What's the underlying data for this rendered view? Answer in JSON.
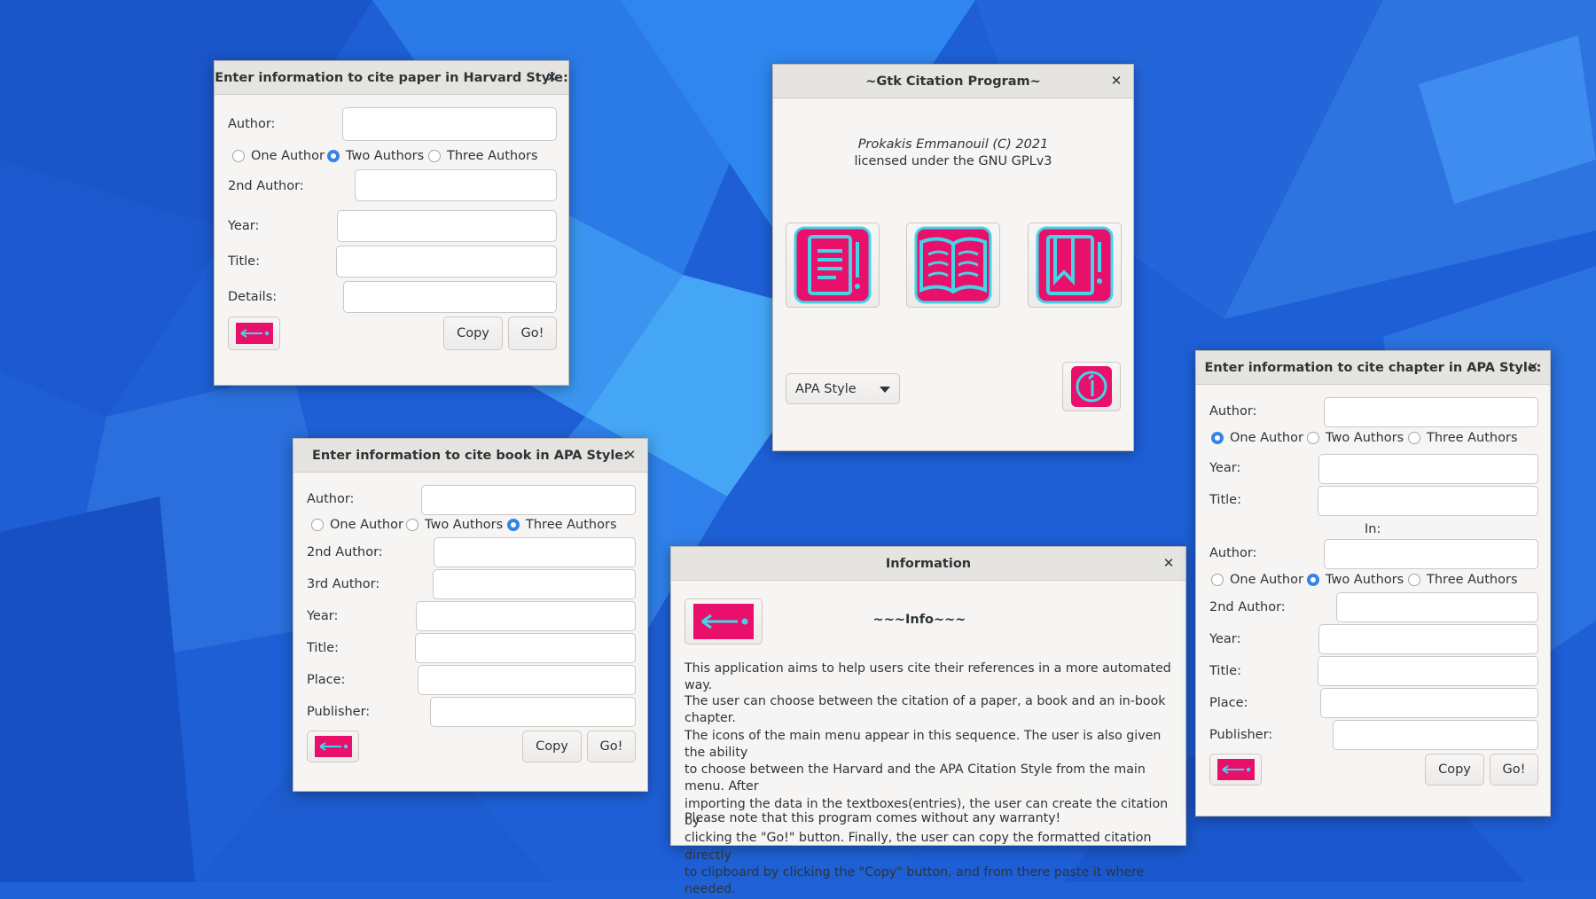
{
  "colors": {
    "accent": "#3584e4",
    "icon_fill": "#e8106b",
    "icon_stroke": "#44d4e6"
  },
  "harvard": {
    "title": "Enter information to cite paper in Harvard Style:",
    "author_label": "Author:",
    "radios": [
      "One Author",
      "Two Authors",
      "Three Authors"
    ],
    "selected": "Two Authors",
    "author2_label": "2nd Author:",
    "year_label": "Year:",
    "title_label": "Title:",
    "details_label": "Details:",
    "copy": "Copy",
    "go": "Go!"
  },
  "main": {
    "title": "~Gtk Citation Program~",
    "credit_line1": "Prokakis Emmanouil (C) 2021",
    "credit_line2": "licensed under the GNU GPLv3",
    "style_select": "APA Style",
    "icons": [
      "paper-icon",
      "book-icon",
      "chapter-icon",
      "info-icon"
    ]
  },
  "book": {
    "title": "Enter information to cite book in APA Style:",
    "author_label": "Author:",
    "radios": [
      "One Author",
      "Two Authors",
      "Three Authors"
    ],
    "selected": "Three Authors",
    "author2_label": "2nd Author:",
    "author3_label": "3rd Author:",
    "year_label": "Year:",
    "title_label": "Title:",
    "place_label": "Place:",
    "publisher_label": "Publisher:",
    "copy": "Copy",
    "go": "Go!"
  },
  "info": {
    "title": "Information",
    "heading": "~~~Info~~~",
    "p1": "This application aims to help users cite their references in a more automated way.",
    "p2": [
      "The user can choose between the citation of a paper, a book and an in-book chapter.",
      "The icons of the main menu appear in this sequence. The user is also given the ability",
      "to choose between the Harvard and the APA Citation Style from the main menu. After",
      "importing the data in the textboxes(entries), the user can create the citation by",
      "clicking the \"Go!\" button. Finally, the user can copy the formatted citation directly",
      "to clipboard by clicking the \"Copy\" button, and from there paste it where needed."
    ],
    "p3": "Please note that this program comes without any warranty!"
  },
  "chapter": {
    "title": "Enter information to cite chapter in APA Style:",
    "author_label": "Author:",
    "radios": [
      "One Author",
      "Two Authors",
      "Three Authors"
    ],
    "selected": "One Author",
    "year_label": "Year:",
    "title_label": "Title:",
    "in_label": "In:",
    "ed_author_label": "Author:",
    "ed_selected": "Two Authors",
    "ed_author2_label": "2nd Author:",
    "ed_year_label": "Year:",
    "ed_title_label": "Title:",
    "place_label": "Place:",
    "publisher_label": "Publisher:",
    "copy": "Copy",
    "go": "Go!"
  }
}
